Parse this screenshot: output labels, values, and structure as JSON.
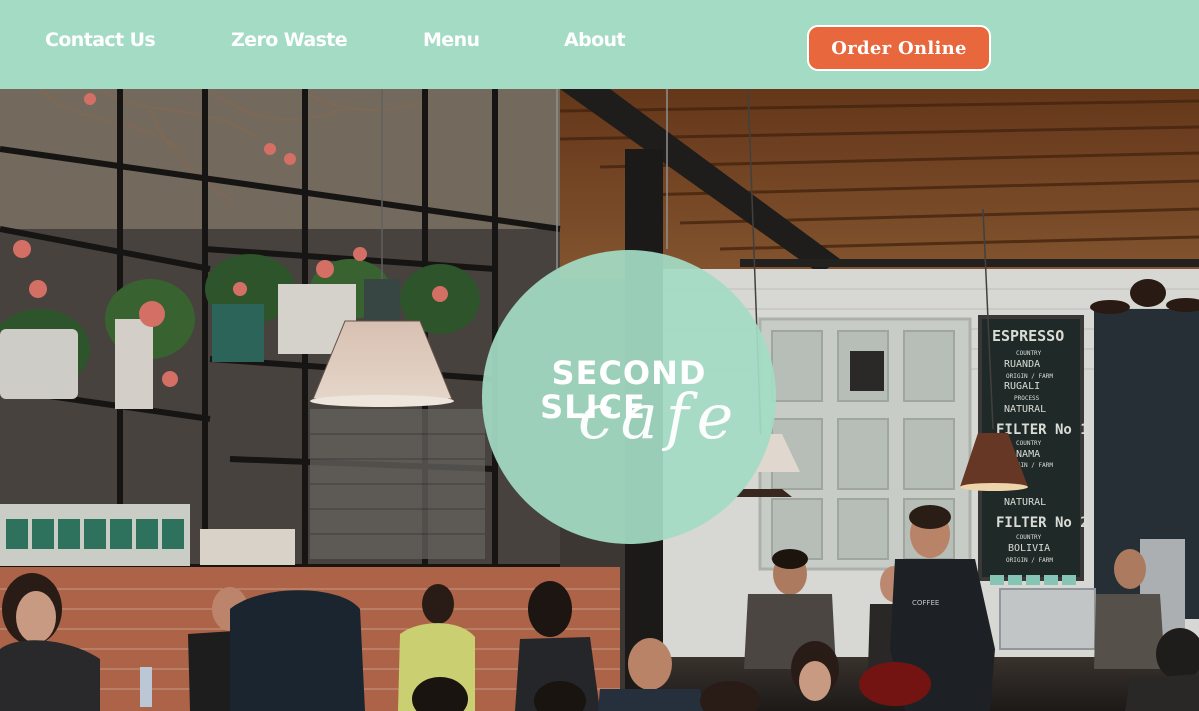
{
  "nav": {
    "links": [
      "Contact Us",
      "Zero Waste",
      "Menu",
      "About"
    ],
    "order_button": "Order Online"
  },
  "logo": {
    "line1": "SECOND",
    "line2": "SLICE",
    "script": "cafe"
  },
  "menu_board": {
    "title": "ESPRESSO",
    "lines": [
      "COUNTRY",
      "RUANDA",
      "ORIGIN / FARM",
      "RUGALI",
      "PROCESS",
      "NATURAL"
    ],
    "filter1_title": "FILTER No 1",
    "filter1_lines": [
      "COUNTRY",
      "PANAMA",
      "ORIGIN / FARM",
      "",
      "NATURAL"
    ],
    "filter2_title": "FILTER No 2",
    "filter2_lines": [
      "COUNTRY",
      "BOLIVIA",
      "ORIGIN / FARM"
    ]
  },
  "colors": {
    "header_bg": "#a4dbc4",
    "button_bg": "#e8673c",
    "logo_circle": "#a4dbc4",
    "text": "#ffffff"
  }
}
